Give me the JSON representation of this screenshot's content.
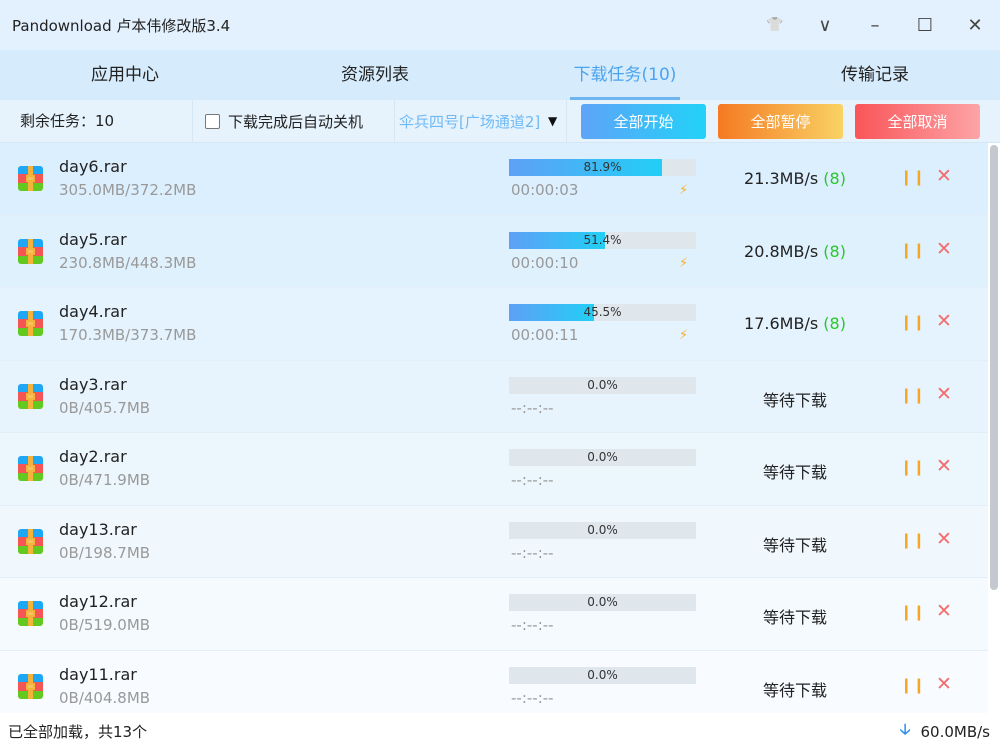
{
  "app": {
    "title": "Pandownload 卢本伟修改版3.4"
  },
  "window_controls": {
    "skin": "👕",
    "menu": "∨",
    "minimize": "–",
    "maximize": "☐",
    "close": "✕"
  },
  "tabs": [
    {
      "label": "应用中心"
    },
    {
      "label": "资源列表"
    },
    {
      "label": "下载任务(10)",
      "active": true
    },
    {
      "label": "传输记录"
    }
  ],
  "toolbar": {
    "remaining": "剩余任务：10",
    "auto_shutdown": "下载完成后自动关机",
    "channel": "伞兵四号[广场通道2]",
    "start_all": "全部开始",
    "pause_all": "全部暂停",
    "cancel_all": "全部取消"
  },
  "tasks": [
    {
      "name": "day6.rar",
      "size": "305.0MB/372.2MB",
      "progress": 81.9,
      "pct": "81.9%",
      "eta": "00:00:03",
      "speed": "21.3MB/s",
      "conn": "(8)",
      "boost": true
    },
    {
      "name": "day5.rar",
      "size": "230.8MB/448.3MB",
      "progress": 51.4,
      "pct": "51.4%",
      "eta": "00:00:10",
      "speed": "20.8MB/s",
      "conn": "(8)",
      "boost": true
    },
    {
      "name": "day4.rar",
      "size": "170.3MB/373.7MB",
      "progress": 45.5,
      "pct": "45.5%",
      "eta": "00:00:11",
      "speed": "17.6MB/s",
      "conn": "(8)",
      "boost": true
    },
    {
      "name": "day3.rar",
      "size": "0B/405.7MB",
      "progress": 0,
      "pct": "0.0%",
      "eta": "--:--:--",
      "speed": "等待下载",
      "conn": "",
      "boost": false
    },
    {
      "name": "day2.rar",
      "size": "0B/471.9MB",
      "progress": 0,
      "pct": "0.0%",
      "eta": "--:--:--",
      "speed": "等待下载",
      "conn": "",
      "boost": false
    },
    {
      "name": "day13.rar",
      "size": "0B/198.7MB",
      "progress": 0,
      "pct": "0.0%",
      "eta": "--:--:--",
      "speed": "等待下载",
      "conn": "",
      "boost": false
    },
    {
      "name": "day12.rar",
      "size": "0B/519.0MB",
      "progress": 0,
      "pct": "0.0%",
      "eta": "--:--:--",
      "speed": "等待下载",
      "conn": "",
      "boost": false
    },
    {
      "name": "day11.rar",
      "size": "0B/404.8MB",
      "progress": 0,
      "pct": "0.0%",
      "eta": "--:--:--",
      "speed": "等待下载",
      "conn": "",
      "boost": false
    }
  ],
  "footer": {
    "status": "已全部加载，共13个",
    "total_speed": "60.0MB/s"
  }
}
